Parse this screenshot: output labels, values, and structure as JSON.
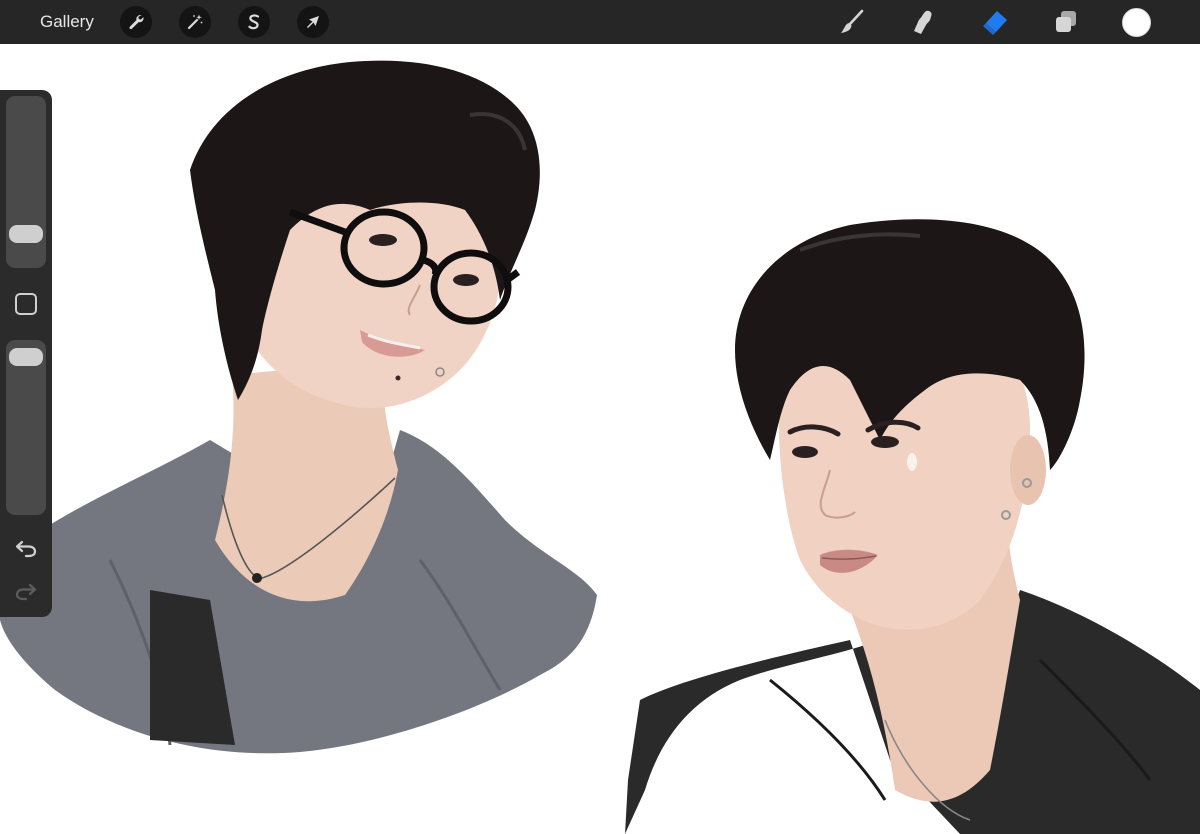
{
  "topbar": {
    "gallery_label": "Gallery",
    "left_tools": [
      {
        "name": "actions",
        "icon": "wrench-icon"
      },
      {
        "name": "adjustments",
        "icon": "magic-wand-icon"
      },
      {
        "name": "selection",
        "icon": "selection-s-icon"
      },
      {
        "name": "transform",
        "icon": "arrow-cursor-icon"
      }
    ],
    "right_tools": [
      {
        "name": "brush",
        "icon": "brush-icon",
        "active": false
      },
      {
        "name": "smudge",
        "icon": "smudge-finger-icon",
        "active": false
      },
      {
        "name": "eraser",
        "icon": "eraser-icon",
        "active": true
      },
      {
        "name": "layers",
        "icon": "layers-icon",
        "active": false
      }
    ],
    "current_color": "#ffffff"
  },
  "sidebar": {
    "brush_size": 0.15,
    "opacity": 0.97,
    "modify_button": "square-modify-icon",
    "undo_icon": "undo-icon",
    "redo_icon": "redo-icon",
    "redo_enabled": false
  },
  "colors": {
    "toolbar_bg": "#262626",
    "accent_blue": "#1f7cf0",
    "hair": "#1c1617",
    "skin": "#efd2c4",
    "gray_jacket": "#74777f",
    "black_jacket": "#2a2a2b"
  }
}
